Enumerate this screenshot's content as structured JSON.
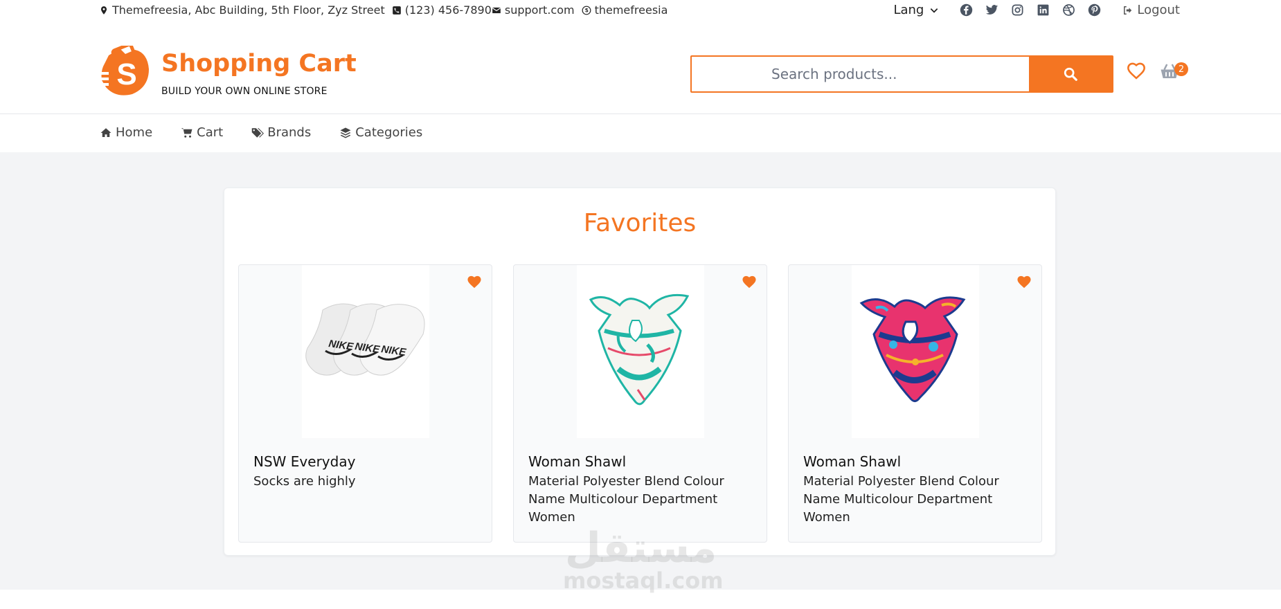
{
  "topbar": {
    "address": "Themefreesia, Abc Building, 5th Floor, Zyz Street",
    "phone": "(123) 456-7890",
    "email": "support.com",
    "skype": "themefreesia",
    "lang_label": "Lang",
    "social_icons": [
      "facebook-icon",
      "twitter-icon",
      "instagram-icon",
      "linkedin-icon",
      "dribbble-icon",
      "pinterest-icon"
    ],
    "logout_label": "Logout"
  },
  "header": {
    "brand_name": "Shopping Cart",
    "brand_tagline": "BUILD YOUR OWN ONLINE STORE",
    "search_placeholder": "Search products...",
    "cart_count": "2"
  },
  "nav": {
    "items": [
      {
        "label": "Home",
        "icon": "home-icon"
      },
      {
        "label": "Cart",
        "icon": "cart-icon"
      },
      {
        "label": "Brands",
        "icon": "tags-icon"
      },
      {
        "label": "Categories",
        "icon": "layers-icon"
      }
    ]
  },
  "favorites": {
    "title": "Favorites",
    "products": [
      {
        "name": "NSW Everyday",
        "description": "Socks are highly",
        "image": "white-socks"
      },
      {
        "name": "Woman Shawl",
        "description": "Material Polyester Blend Colour Name Multicolour Department Women",
        "image": "teal-shawl"
      },
      {
        "name": "Woman Shawl",
        "description": "Material Polyester Blend Colour Name Multicolour Department Women",
        "image": "pink-shawl"
      }
    ]
  },
  "watermark": {
    "arabic": "مستقل",
    "latin": "mostaql.com"
  },
  "colors": {
    "accent": "#f47522",
    "background": "#f3f4f6",
    "text": "#222222"
  }
}
